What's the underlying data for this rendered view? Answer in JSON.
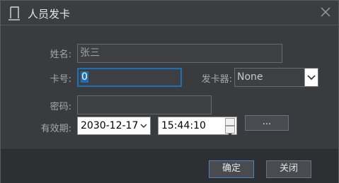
{
  "window": {
    "title": "人员发卡"
  },
  "form": {
    "name_label": "姓名:",
    "name_value": "张三",
    "card_label": "卡号:",
    "card_value": "0",
    "issuer_label": "发卡器:",
    "issuer_value": "None",
    "password_label": "密码:",
    "password_value": "",
    "validity_label": "有效期:",
    "date_value": "2030-12-17",
    "time_value": "15:44:10",
    "more_button": "..."
  },
  "footer": {
    "ok_label": "确定",
    "close_label": "关闭"
  },
  "colors": {
    "accent": "#1e6fb6",
    "background": "#3a3b3f",
    "footer": "#2e2f33"
  }
}
